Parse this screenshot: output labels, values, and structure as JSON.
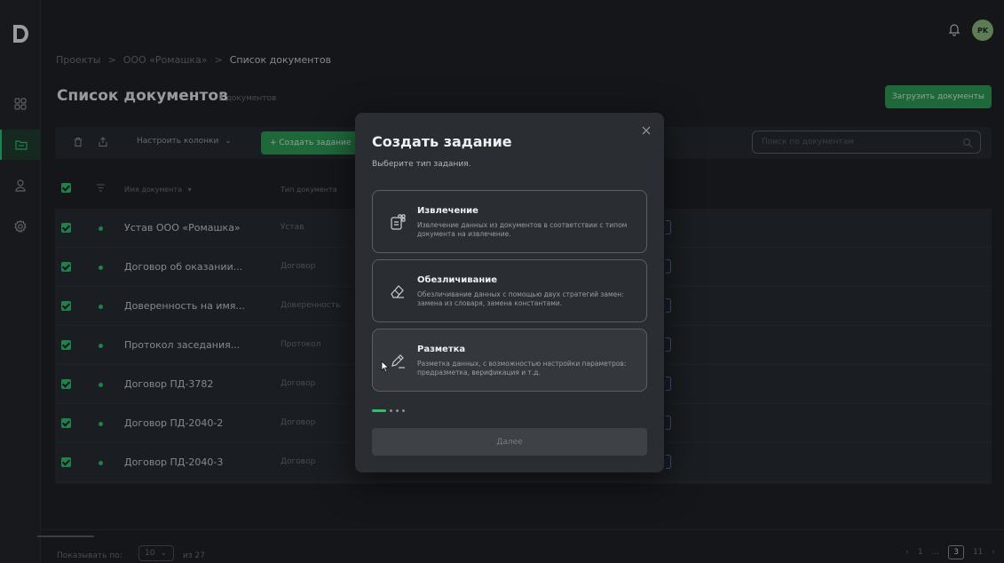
{
  "app": {
    "logo": "D",
    "avatar_initials": "PK"
  },
  "rail": {
    "items": [
      {
        "icon": "grid-icon"
      },
      {
        "icon": "folder-icon",
        "active": true
      },
      {
        "icon": "user-icon"
      },
      {
        "icon": "gear-icon"
      }
    ]
  },
  "breadcrumb": {
    "items": [
      "Проекты",
      "ООО «Ромашка»",
      "Список документов"
    ],
    "separator": ">"
  },
  "page": {
    "title": "Список документов",
    "count": "7 документов",
    "upload_label": "Загрузить документы"
  },
  "toolbar": {
    "columns_label": "Настроить колонки",
    "create_label": "+ Создать задание",
    "search_placeholder": "Поиск по документам"
  },
  "table": {
    "headers": [
      "Имя документа",
      "Тип документа"
    ],
    "rows": [
      {
        "name": "Устав ООО «Ромашка»",
        "type": "Устав"
      },
      {
        "name": "Договор об оказании...",
        "type": "Договор"
      },
      {
        "name": "Доверенность на имя...",
        "type": "Доверенность"
      },
      {
        "name": "Протокол заседания...",
        "type": "Протокол"
      },
      {
        "name": "Договор ПД-3782",
        "type": "Договор"
      },
      {
        "name": "Договор ПД-2040-2",
        "type": "Договор"
      },
      {
        "name": "Договор ПД-2040-3",
        "type": "Договор"
      }
    ]
  },
  "footer": {
    "show_label": "Показывать по:",
    "page_size": "10",
    "of_label": "из 27",
    "pages": [
      "1",
      "...",
      "3",
      "11"
    ],
    "current_page": "3"
  },
  "modal": {
    "title": "Создать задание",
    "subtitle": "Выберите тип задания.",
    "options": [
      {
        "title": "Извлечение",
        "desc": "Извлечение данных из документов в соответствии с типом документа на извлечение.",
        "icon": "extract-icon"
      },
      {
        "title": "Обезличивание",
        "desc": "Обезличивание данных с помощью двух стратегий замен: замена из словаря, замена константами.",
        "icon": "eraser-icon"
      },
      {
        "title": "Разметка",
        "desc": "Разметка данных, с возможностью настройки параметров: предразметка, верификация и т.д.",
        "icon": "pencil-icon"
      }
    ],
    "next_label": "Далее"
  },
  "colors": {
    "accent": "#2fbf6d",
    "background": "#1b1d20",
    "modal": "#2a2d31"
  }
}
